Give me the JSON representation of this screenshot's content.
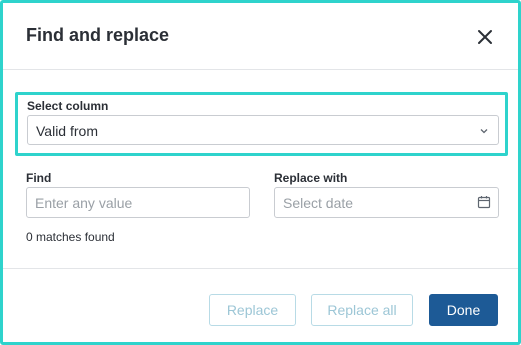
{
  "dialog": {
    "title": "Find and replace",
    "close_icon": "close-icon"
  },
  "select_column": {
    "label": "Select column",
    "value": "Valid from",
    "chevron_icon": "chevron-down-icon"
  },
  "find": {
    "label": "Find",
    "placeholder": "Enter any value"
  },
  "replace_with": {
    "label": "Replace with",
    "placeholder": "Select date",
    "calendar_icon": "calendar-icon"
  },
  "matches_text": "0 matches found",
  "buttons": {
    "replace": "Replace",
    "replace_all": "Replace all",
    "done": "Done"
  },
  "colors": {
    "highlight": "#2ed3cc",
    "primary": "#1d5a96",
    "disabled_text": "#9cc6d6"
  }
}
